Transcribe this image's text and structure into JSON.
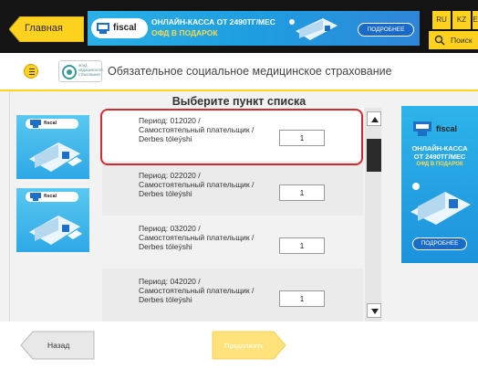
{
  "header": {
    "home_label": "Главная",
    "banner": {
      "logo_text": "fiscal",
      "logo_sup": "pult",
      "title": "ОНЛАЙН-КАССА ОТ 2490ТГ/МЕС",
      "subtitle": "ОФД В ПОДАРОК",
      "more_label": "ПОДРОБНЕЕ"
    },
    "languages": [
      "RU",
      "KZ",
      "E"
    ],
    "search_label": "Поиск"
  },
  "title_strip": {
    "menu_icon": "list-icon",
    "org_logo_lines": [
      "ФОНД",
      "МЕДИЦИНСКОГО",
      "СТРАХОВАНИЯ"
    ],
    "page_title": "Обязательное социальное медицинское страхование"
  },
  "content": {
    "heading": "Выберите пункт списка",
    "items": [
      {
        "line1": "Период: 012020 /",
        "line2": "Самостоятельный плательщик /",
        "line3": "Derbes tóleýshi",
        "qty": "1",
        "selected": true
      },
      {
        "line1": "Период: 022020 /",
        "line2": "Самостоятельный плательщик /",
        "line3": "Derbes tóleýshi",
        "qty": "1",
        "selected": false
      },
      {
        "line1": "Период: 032020 /",
        "line2": "Самостоятельный плательщик /",
        "line3": "Derbes tóleýshi",
        "qty": "1",
        "selected": false
      },
      {
        "line1": "Период: 042020 /",
        "line2": "Самостоятельный плательщик /",
        "line3": "Derbes tóleýshi",
        "qty": "1",
        "selected": false
      }
    ],
    "left_ads": [
      {
        "logo_text": "fiscal",
        "logo_sup": "pult"
      },
      {
        "logo_text": "fiscal",
        "logo_sup": "pult"
      }
    ],
    "right_ad": {
      "logo_text": "fiscal",
      "logo_sup": "pult",
      "title_line1": "ОНЛАЙН-КАССА",
      "title_line2": "ОТ 2490ТГ/МЕС",
      "subtitle": "ОФД В ПОДАРОК",
      "more_label": "ПОДРОБНЕЕ"
    }
  },
  "footer": {
    "back_label": "Назад",
    "next_label": "Продолжить"
  },
  "colors": {
    "accent_yellow": "#ffd21f",
    "selection_red": "#d8282c",
    "banner_blue": "#1e9ee0"
  }
}
